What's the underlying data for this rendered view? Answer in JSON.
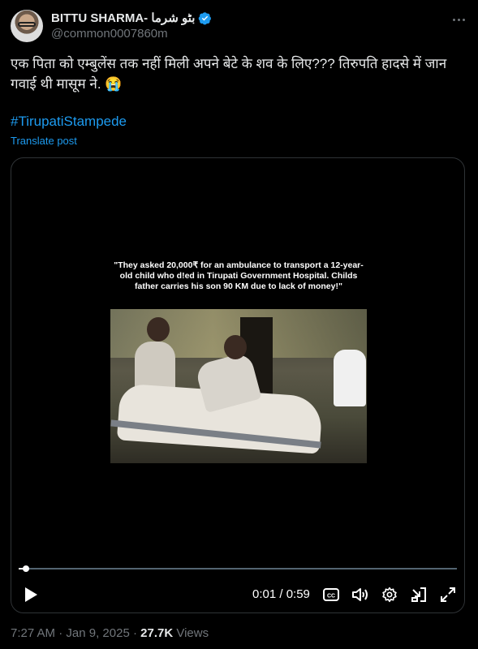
{
  "author": {
    "name": "BITTU SHARMA- بٹو شرما",
    "handle": "@common0007860m",
    "verified": true
  },
  "tweet": {
    "text": "एक पिता को एम्बुलेंस तक नहीं मिली अपने बेटे के शव के लिए??? तिरुपति हादसे में जान गवाई थी मासूम ने. 😭",
    "hashtag": "#TirupatiStampede",
    "translate_label": "Translate post"
  },
  "video": {
    "caption": "\"They asked 20,000₹ for an ambulance to transport a 12-year-old child who d!ed in Tirupati Government Hospital. Childs father carries his son 90 KM due to lack of money!\"",
    "time_display": "0:01 / 0:59",
    "progress": 0.017
  },
  "icons": {
    "more": "more-icon",
    "play": "play-icon",
    "captions": "captions-icon",
    "volume": "volume-icon",
    "settings": "settings-icon",
    "pip": "picture-in-picture-icon",
    "fullscreen": "fullscreen-icon",
    "verified": "verified-badge-icon"
  },
  "meta": {
    "time": "7:27 AM",
    "sep1": "·",
    "date": "Jan 9, 2025",
    "sep2": "·",
    "views_count": "27.7K",
    "views_label": "Views"
  },
  "colors": {
    "background": "#000000",
    "text": "#e7e9ea",
    "secondary": "#71767b",
    "link": "#1d9bf0",
    "border": "#2f3336"
  }
}
